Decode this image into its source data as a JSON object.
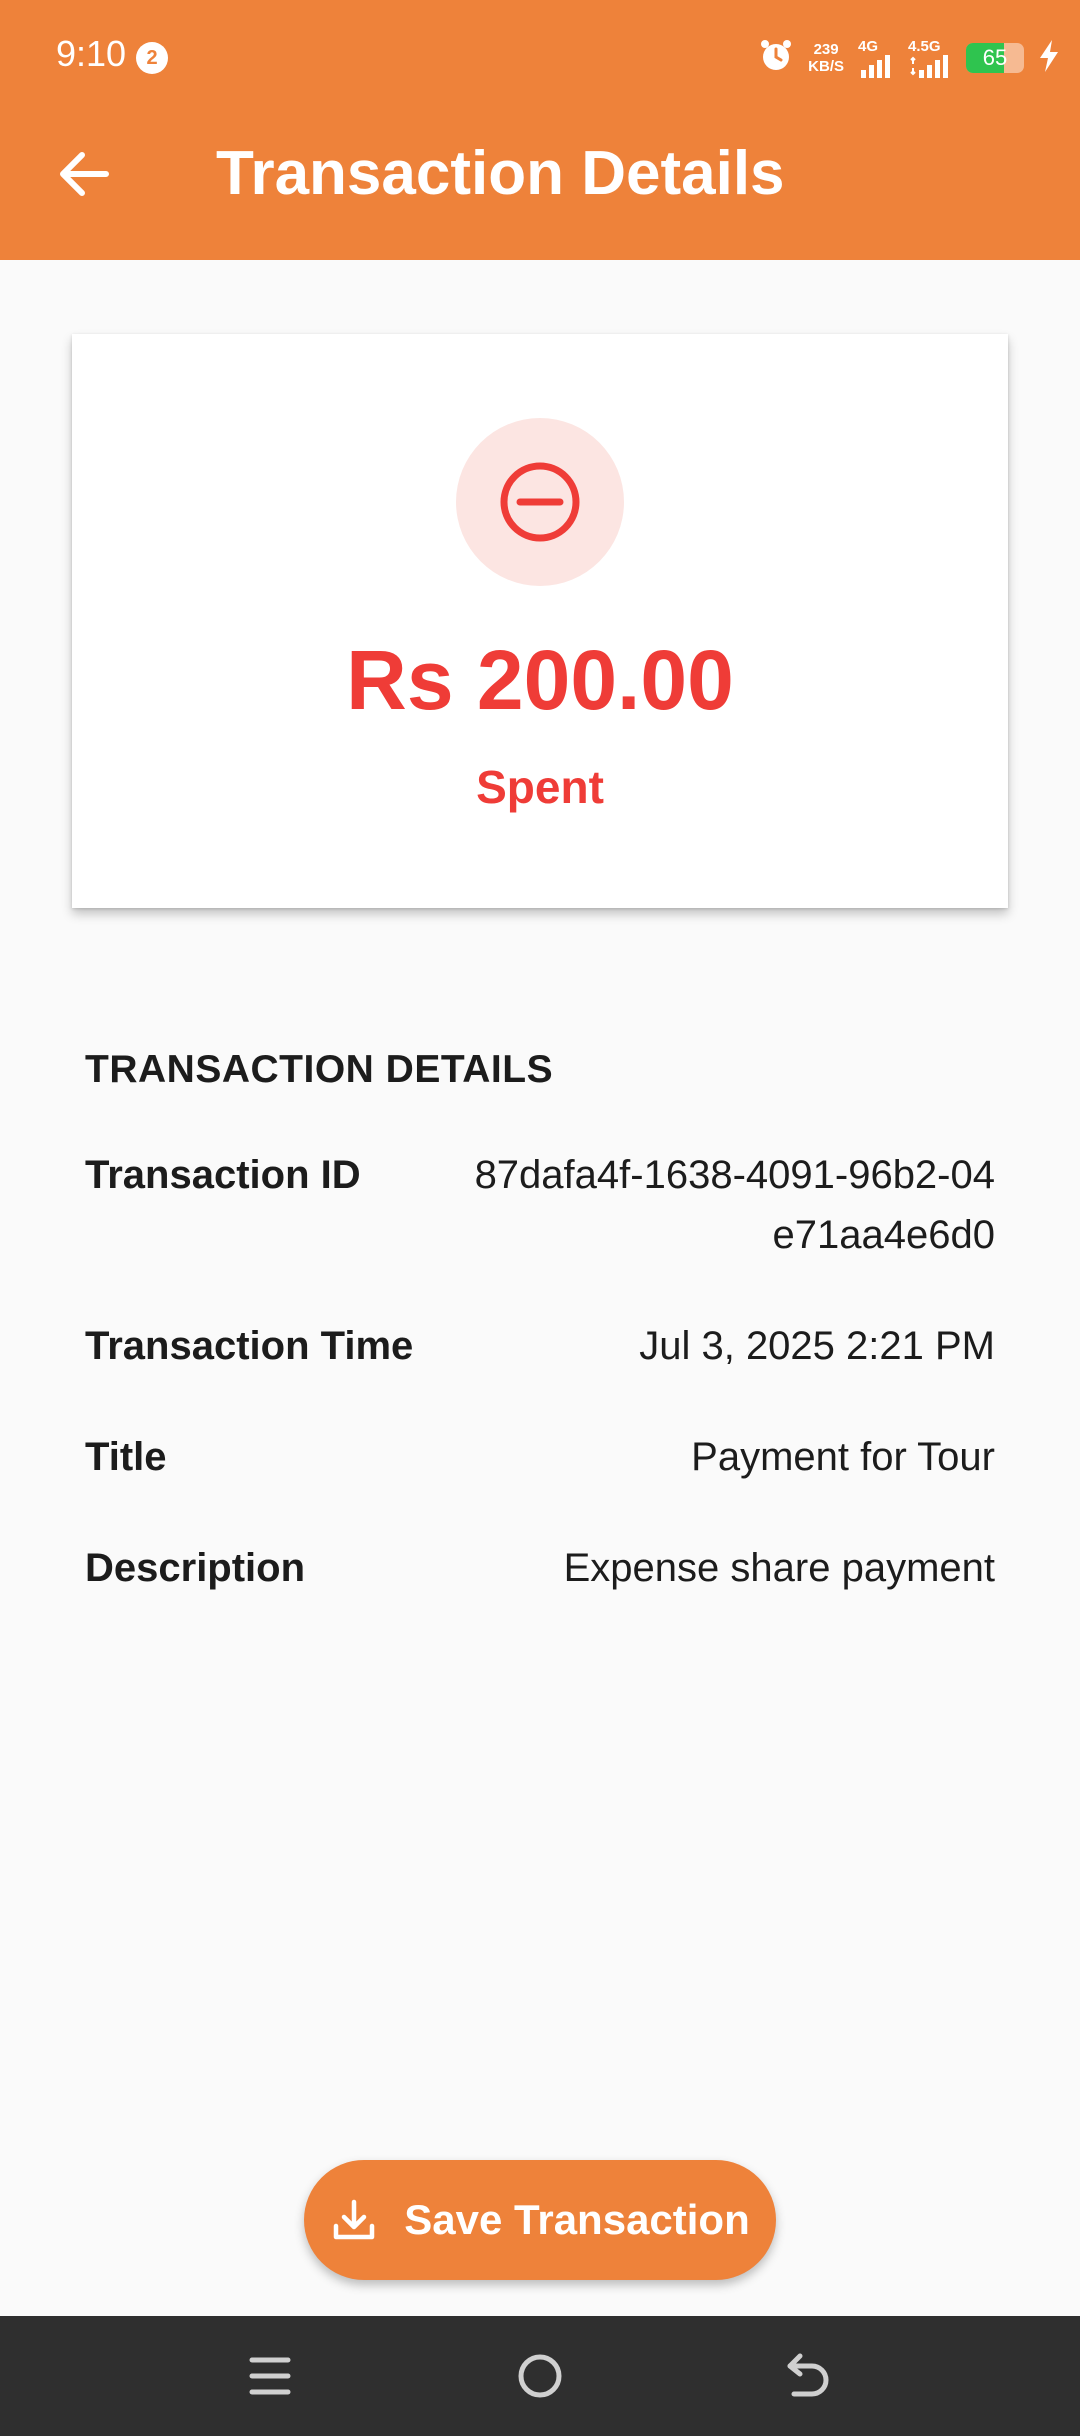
{
  "status_bar": {
    "time": "9:10",
    "notification_count": "2",
    "net_speed_value": "239",
    "net_speed_unit": "KB/S",
    "network_1": "4G",
    "network_2": "4.5G",
    "battery_level": "65",
    "icons": [
      "alarm-icon",
      "signal-icon",
      "signal-icon",
      "battery-icon",
      "charging-icon"
    ]
  },
  "app_bar": {
    "title": "Transaction Details",
    "back_icon": "arrow-left-icon"
  },
  "amount_card": {
    "icon": "minus-circle-icon",
    "amount": "Rs 200.00",
    "status": "Spent"
  },
  "details": {
    "heading": "TRANSACTION DETAILS",
    "rows": [
      {
        "label": "Transaction ID",
        "value": "87dafa4f-1638-4091-96b2-04e71aa4e6d0"
      },
      {
        "label": "Transaction Time",
        "value": "Jul 3, 2025 2:21 PM"
      },
      {
        "label": "Title",
        "value": "Payment for Tour"
      },
      {
        "label": "Description",
        "value": "Expense share payment"
      }
    ]
  },
  "save_button": {
    "label": "Save Transaction",
    "icon": "download-icon"
  },
  "nav_bar": {
    "icons": [
      "menu-icon",
      "home-icon",
      "back-icon"
    ]
  },
  "colors": {
    "primary": "#ee823a",
    "expense": "#ef3c37",
    "expense_bg": "#fce5e2",
    "battery": "#2fc44f"
  }
}
